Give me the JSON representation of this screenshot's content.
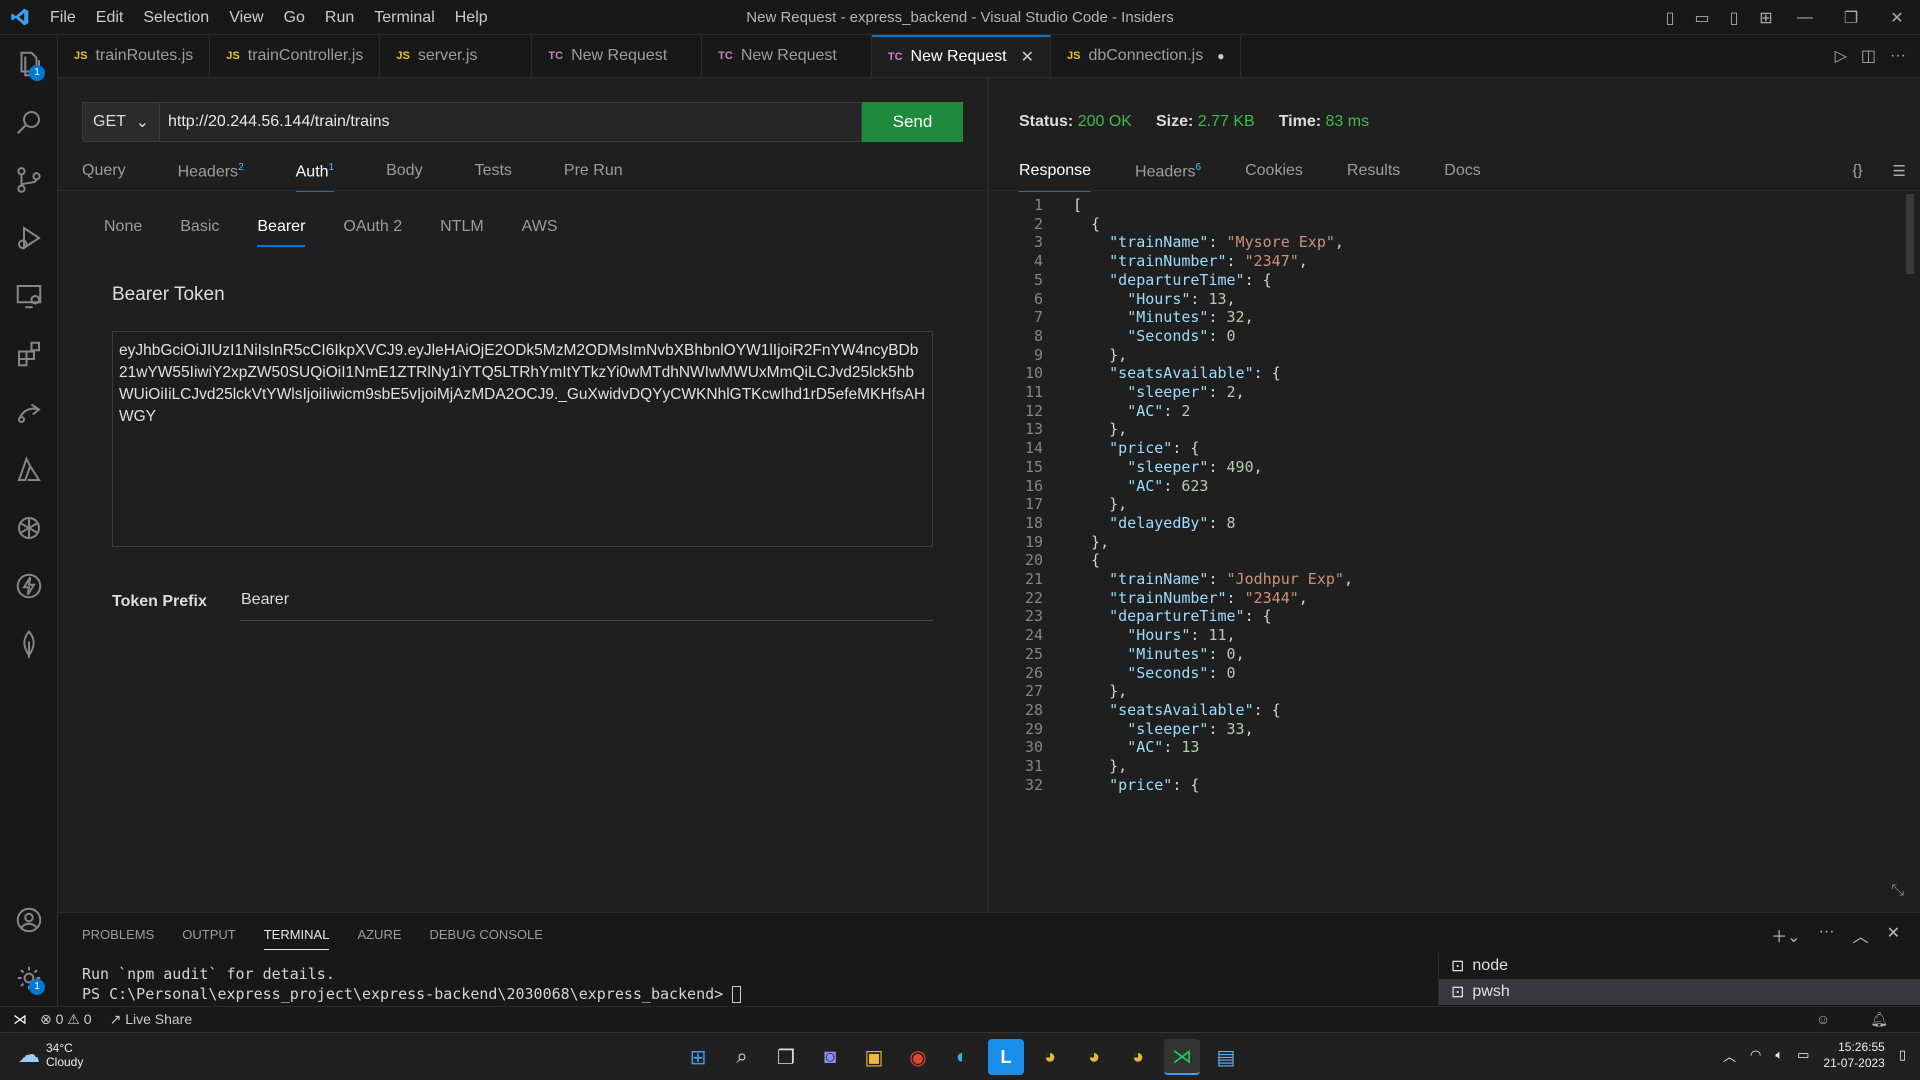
{
  "titlebar": {
    "menu": [
      "File",
      "Edit",
      "Selection",
      "View",
      "Go",
      "Run",
      "Terminal",
      "Help"
    ],
    "title": "New Request - express_backend - Visual Studio Code - Insiders"
  },
  "activity_badges": {
    "explorer": "1",
    "settings": "1"
  },
  "tabs": [
    {
      "icon": "JS",
      "label": "trainRoutes.js"
    },
    {
      "icon": "JS",
      "label": "trainController.js"
    },
    {
      "icon": "JS",
      "label": "server.js"
    },
    {
      "icon": "TC",
      "label": "New Request"
    },
    {
      "icon": "TC",
      "label": "New Request"
    },
    {
      "icon": "TC",
      "label": "New Request"
    },
    {
      "icon": "JS",
      "label": "dbConnection.js"
    }
  ],
  "request": {
    "method": "GET",
    "url": "http://20.244.56.144/train/trains",
    "send_label": "Send",
    "tabs": {
      "query": "Query",
      "headers": "Headers",
      "headers_count": "2",
      "auth": "Auth",
      "auth_count": "1",
      "body": "Body",
      "tests": "Tests",
      "prerun": "Pre Run"
    },
    "auth_types": [
      "None",
      "Basic",
      "Bearer",
      "OAuth 2",
      "NTLM",
      "AWS"
    ],
    "bearer_label": "Bearer Token",
    "token": "eyJhbGciOiJIUzI1NiIsInR5cCI6IkpXVCJ9.eyJleHAiOjE2ODk5MzM2ODMsImNvbXBhbnlOYW1lIjoiR2FnYW4ncyBDb21wYW55IiwiY2xpZW50SUQiOiI1NmE1ZTRlNy1iYTQ5LTRhYmItYTkzYi0wMTdhNWIwMWUxMmQiLCJvd25lck5hbWUiOiIiLCJvd25lckVtYWlsIjoiIiwicm9sbE5vIjoiMjAzMDA2OCJ9._GuXwidvDQYyCWKNhlGTKcwIhd1rD5efeMKHfsAHWGY",
    "prefix_label": "Token Prefix",
    "prefix_value": "Bearer"
  },
  "response": {
    "status_label": "Status:",
    "status_value": "200 OK",
    "size_label": "Size:",
    "size_value": "2.77 KB",
    "time_label": "Time:",
    "time_value": "83 ms",
    "tabs": {
      "response": "Response",
      "headers": "Headers",
      "headers_count": "6",
      "cookies": "Cookies",
      "results": "Results",
      "docs": "Docs"
    },
    "braces_icon": "{}",
    "code_lines": [
      "[",
      "  {",
      "    \"trainName\": \"Mysore Exp\",",
      "    \"trainNumber\": \"2347\",",
      "    \"departureTime\": {",
      "      \"Hours\": 13,",
      "      \"Minutes\": 32,",
      "      \"Seconds\": 0",
      "    },",
      "    \"seatsAvailable\": {",
      "      \"sleeper\": 2,",
      "      \"AC\": 2",
      "    },",
      "    \"price\": {",
      "      \"sleeper\": 490,",
      "      \"AC\": 623",
      "    },",
      "    \"delayedBy\": 8",
      "  },",
      "  {",
      "    \"trainName\": \"Jodhpur Exp\",",
      "    \"trainNumber\": \"2344\",",
      "    \"departureTime\": {",
      "      \"Hours\": 11,",
      "      \"Minutes\": 0,",
      "      \"Seconds\": 0",
      "    },",
      "    \"seatsAvailable\": {",
      "      \"sleeper\": 33,",
      "      \"AC\": 13",
      "    },",
      "    \"price\": {"
    ]
  },
  "panel": {
    "tabs": [
      "PROBLEMS",
      "OUTPUT",
      "TERMINAL",
      "AZURE",
      "DEBUG CONSOLE"
    ],
    "active_tab": "TERMINAL",
    "terminal_lines": [
      "Run `npm audit` for details.",
      "PS C:\\Personal\\express_project\\express-backend\\2030068\\express_backend> "
    ],
    "terminals": [
      "node",
      "pwsh"
    ]
  },
  "statusbar": {
    "errors": "0",
    "warnings": "0",
    "live_share": "Live Share"
  },
  "taskbar": {
    "temp": "34°C",
    "weather": "Cloudy",
    "time": "15:26:55",
    "date": "21-07-2023"
  },
  "colors": {
    "accent": "#0078d4",
    "send": "#1f8a3b",
    "ok": "#3fb950"
  }
}
